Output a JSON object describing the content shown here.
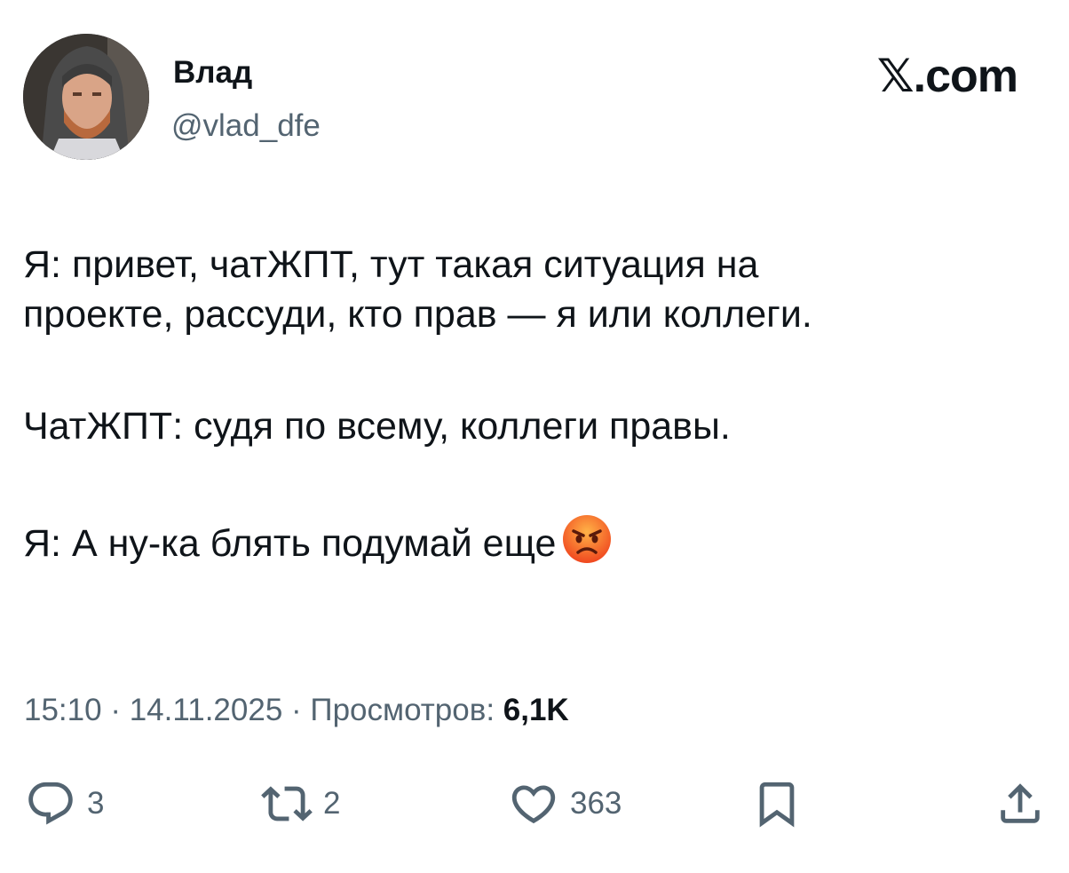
{
  "author": {
    "name": "Влад",
    "handle": "@vlad_dfe"
  },
  "brand": "𝕏.com",
  "tweet": {
    "lines": [
      "Я: привет, чатЖПТ, тут такая ситуация на",
      "проекте, рассуди, кто прав — я или коллеги.",
      "ЧатЖПТ: судя по всему, коллеги правы.",
      "Я: А ну-ка блять подумай еще"
    ],
    "emoji": "angry-face"
  },
  "meta": {
    "time": "15:10",
    "date": "14.11.2025",
    "views_label": "Просмотров:",
    "views_count": "6,1K",
    "separator": "·"
  },
  "actions": {
    "replies": "3",
    "retweets": "2",
    "likes": "363"
  },
  "colors": {
    "text": "#0f1419",
    "secondary": "#536471",
    "background": "#ffffff"
  }
}
